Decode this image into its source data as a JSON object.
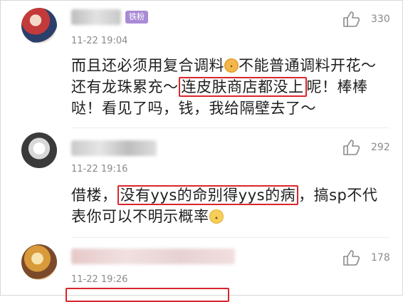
{
  "comments": [
    {
      "badge": "铁粉",
      "time": "11-22 19:04",
      "likes": "330",
      "text_before": "而且还必须用复合调料",
      "text_after_emoji": "不能普通调料开花～还有龙珠累充～",
      "highlight": "连皮肤商店都没上",
      "text_end": "呢！棒棒哒！看见了吗，钱，我给隔壁去了～"
    },
    {
      "time": "11-22 19:16",
      "likes": "292",
      "text_before": "借楼，",
      "highlight": "没有yys的命别得yys的病",
      "text_end": "，搞sp不代表你可以不明示概率"
    },
    {
      "time": "11-22 19:26",
      "likes": "178"
    }
  ],
  "colors": {
    "highlight": "#d9262c",
    "badge": "#a98ad6",
    "meta": "#8a8a8a"
  },
  "icons": [
    "thumbs-up-icon",
    "emoji-face-icon"
  ]
}
